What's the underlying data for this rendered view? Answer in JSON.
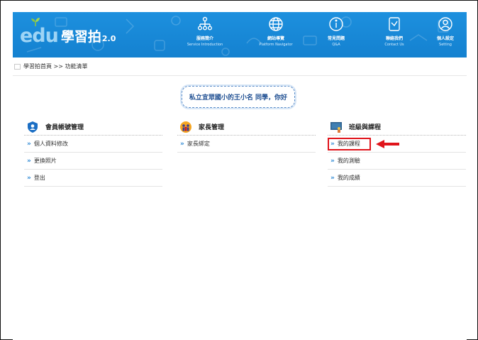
{
  "header": {
    "logo": {
      "edu": "edu",
      "name": "學習拍",
      "version": "2.0"
    },
    "nav": [
      {
        "zh": "服務簡介",
        "en": "Service Introduction",
        "icon": "org-chart-icon"
      },
      {
        "zh": "網站導覽",
        "en": "Platform Navigator",
        "icon": "globe-icon"
      },
      {
        "zh": "常見問題",
        "en": "Q&A",
        "icon": "info-icon"
      },
      {
        "zh": "聯絡我們",
        "en": "Contact Us",
        "icon": "contact-icon"
      },
      {
        "zh": "個人設定",
        "en": "Setting",
        "icon": "user-circle-icon"
      }
    ],
    "colors": {
      "bar": "#1a8bd8",
      "logo_edu": "#9ed4f5"
    }
  },
  "breadcrumb": {
    "text": "學習拍首頁 >> 功能清單"
  },
  "greeting": {
    "text": "私立宜眾國小的王小名 同學，你好"
  },
  "columns": [
    {
      "title": "會員帳號管理",
      "icon": "shield-user-icon",
      "items": [
        "個人資料修改",
        "更換照片",
        "登出"
      ]
    },
    {
      "title": "家長管理",
      "icon": "family-icon",
      "items": [
        "家長綁定"
      ]
    },
    {
      "title": "班級與課程",
      "icon": "classroom-icon",
      "items": [
        "我的課程",
        "我的測驗",
        "我的成績"
      ],
      "highlighted_item": "我的課程"
    }
  ],
  "annotation": {
    "color": "#e0141b",
    "target": "我的課程"
  }
}
